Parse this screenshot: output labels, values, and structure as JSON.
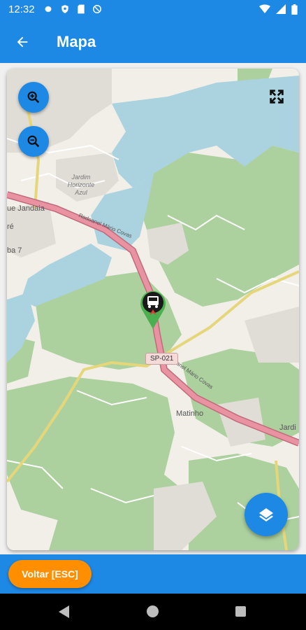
{
  "status_bar": {
    "time": "12:32",
    "left_icons": [
      "gear-icon",
      "shield-icon",
      "sd-card-icon",
      "no-disturb-icon"
    ],
    "right_icons": [
      "wifi-icon",
      "signal-icon",
      "battery-icon"
    ]
  },
  "app_bar": {
    "title": "Mapa",
    "back_icon": "arrow-left-icon"
  },
  "map": {
    "controls": {
      "zoom_in_icon": "zoom-in-icon",
      "zoom_out_icon": "zoom-out-icon",
      "fullscreen_icon": "fullscreen-icon",
      "layers_icon": "layers-icon"
    },
    "labels": {
      "jardim_horizonte_azul": "Jardim\nHorizonte\nAzul",
      "que_jandaia": "ue Jandaia",
      "re": "ré",
      "ba7": "ba 7",
      "matinho": "Matinho",
      "jardi": "Jardi",
      "road_name_1": "Rodoanel Mário Covas",
      "road_name_2": "Rodoanel Mário Covas",
      "road_shield": "SP-021"
    },
    "marker": "truck-marker-icon"
  },
  "bottom_bar": {
    "back_button_label": "Voltar [ESC]"
  },
  "colors": {
    "primary": "#1e88e5",
    "accent": "#ff8f00",
    "water": "#aad3df",
    "forest": "#add19e",
    "highway": "#e892a2"
  }
}
